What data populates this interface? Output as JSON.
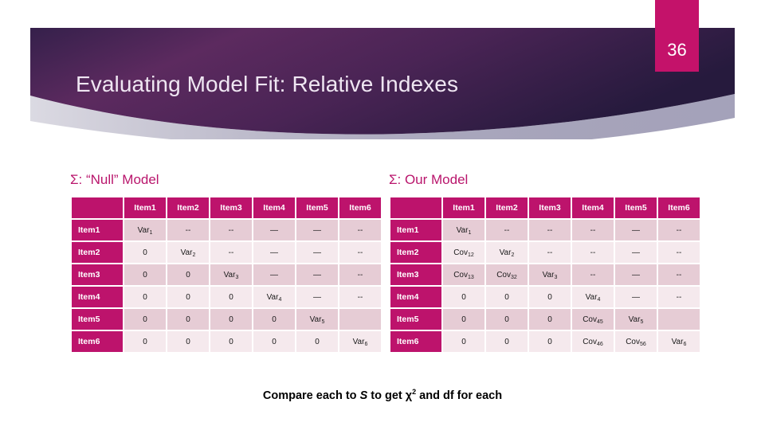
{
  "slide": {
    "title": "Evaluating Model Fit: Relative Indexes",
    "number": "36",
    "caption_pre": "Compare each to ",
    "caption_var": "S",
    "caption_mid": " to get χ",
    "caption_sup": "2",
    "caption_post": " and df for each"
  },
  "colors": {
    "header_magenta": "#bd136c",
    "slide_number_bg": "#c4126a",
    "banner_dark": "#2b1d44",
    "banner_mid": "#5b2a5e",
    "banner_light_sweep": "#8d8aa8",
    "panel_title": "#b9156c",
    "row_dark": "#e6ccd5",
    "row_light": "#f5e9ed",
    "title_text": "#efe6f2"
  },
  "panels": [
    {
      "id": "null-model",
      "title": "Σ: “Null” Model",
      "columns": [
        "Item1",
        "Item2",
        "Item3",
        "Item4",
        "Item5",
        "Item6"
      ],
      "rows": [
        {
          "label": "Item1",
          "band": "dark",
          "cells": [
            {
              "base": "Var",
              "sub": "1"
            },
            {
              "base": "--",
              "sub": ""
            },
            {
              "base": "--",
              "sub": ""
            },
            {
              "base": "—",
              "sub": ""
            },
            {
              "base": "—",
              "sub": ""
            },
            {
              "base": "--",
              "sub": ""
            }
          ]
        },
        {
          "label": "Item2",
          "band": "light",
          "cells": [
            {
              "base": "0",
              "sub": ""
            },
            {
              "base": "Var",
              "sub": "2"
            },
            {
              "base": "--",
              "sub": ""
            },
            {
              "base": "—",
              "sub": ""
            },
            {
              "base": "—",
              "sub": ""
            },
            {
              "base": "--",
              "sub": ""
            }
          ]
        },
        {
          "label": "Item3",
          "band": "dark",
          "cells": [
            {
              "base": "0",
              "sub": ""
            },
            {
              "base": "0",
              "sub": ""
            },
            {
              "base": "Var",
              "sub": "3"
            },
            {
              "base": "—",
              "sub": ""
            },
            {
              "base": "—",
              "sub": ""
            },
            {
              "base": "--",
              "sub": ""
            }
          ]
        },
        {
          "label": "Item4",
          "band": "light",
          "cells": [
            {
              "base": "0",
              "sub": ""
            },
            {
              "base": "0",
              "sub": ""
            },
            {
              "base": "0",
              "sub": ""
            },
            {
              "base": "Var",
              "sub": "4"
            },
            {
              "base": "—",
              "sub": ""
            },
            {
              "base": "--",
              "sub": ""
            }
          ]
        },
        {
          "label": "Item5",
          "band": "dark",
          "cells": [
            {
              "base": "0",
              "sub": ""
            },
            {
              "base": "0",
              "sub": ""
            },
            {
              "base": "0",
              "sub": ""
            },
            {
              "base": "0",
              "sub": ""
            },
            {
              "base": "Var",
              "sub": "5"
            },
            {
              "base": "",
              "sub": ""
            }
          ]
        },
        {
          "label": "Item6",
          "band": "light",
          "cells": [
            {
              "base": "0",
              "sub": ""
            },
            {
              "base": "0",
              "sub": ""
            },
            {
              "base": "0",
              "sub": ""
            },
            {
              "base": "0",
              "sub": ""
            },
            {
              "base": "0",
              "sub": ""
            },
            {
              "base": "Var",
              "sub": "6"
            }
          ]
        }
      ]
    },
    {
      "id": "our-model",
      "title": "Σ: Our Model",
      "columns": [
        "Item1",
        "Item2",
        "Item3",
        "Item4",
        "Item5",
        "Item6"
      ],
      "rows": [
        {
          "label": "Item1",
          "band": "dark",
          "cells": [
            {
              "base": "Var",
              "sub": "1"
            },
            {
              "base": "--",
              "sub": ""
            },
            {
              "base": "--",
              "sub": ""
            },
            {
              "base": "--",
              "sub": ""
            },
            {
              "base": "—",
              "sub": ""
            },
            {
              "base": "--",
              "sub": ""
            }
          ]
        },
        {
          "label": "Item2",
          "band": "light",
          "cells": [
            {
              "base": "Cov",
              "sub": "12"
            },
            {
              "base": "Var",
              "sub": "2"
            },
            {
              "base": "--",
              "sub": ""
            },
            {
              "base": "--",
              "sub": ""
            },
            {
              "base": "—",
              "sub": ""
            },
            {
              "base": "--",
              "sub": ""
            }
          ]
        },
        {
          "label": "Item3",
          "band": "dark",
          "cells": [
            {
              "base": "Cov",
              "sub": "13"
            },
            {
              "base": "Cov",
              "sub": "32"
            },
            {
              "base": "Var",
              "sub": "3"
            },
            {
              "base": "--",
              "sub": ""
            },
            {
              "base": "—",
              "sub": ""
            },
            {
              "base": "--",
              "sub": ""
            }
          ]
        },
        {
          "label": "Item4",
          "band": "light",
          "cells": [
            {
              "base": "0",
              "sub": ""
            },
            {
              "base": "0",
              "sub": ""
            },
            {
              "base": "0",
              "sub": ""
            },
            {
              "base": "Var",
              "sub": "4"
            },
            {
              "base": "—",
              "sub": ""
            },
            {
              "base": "--",
              "sub": ""
            }
          ]
        },
        {
          "label": "Item5",
          "band": "dark",
          "cells": [
            {
              "base": "0",
              "sub": ""
            },
            {
              "base": "0",
              "sub": ""
            },
            {
              "base": "0",
              "sub": ""
            },
            {
              "base": "Cov",
              "sub": "45"
            },
            {
              "base": "Var",
              "sub": "5"
            },
            {
              "base": "",
              "sub": ""
            }
          ]
        },
        {
          "label": "Item6",
          "band": "light",
          "cells": [
            {
              "base": "0",
              "sub": ""
            },
            {
              "base": "0",
              "sub": ""
            },
            {
              "base": "0",
              "sub": ""
            },
            {
              "base": "Cov",
              "sub": "46"
            },
            {
              "base": "Cov",
              "sub": "56"
            },
            {
              "base": "Var",
              "sub": "6"
            }
          ]
        }
      ]
    }
  ]
}
